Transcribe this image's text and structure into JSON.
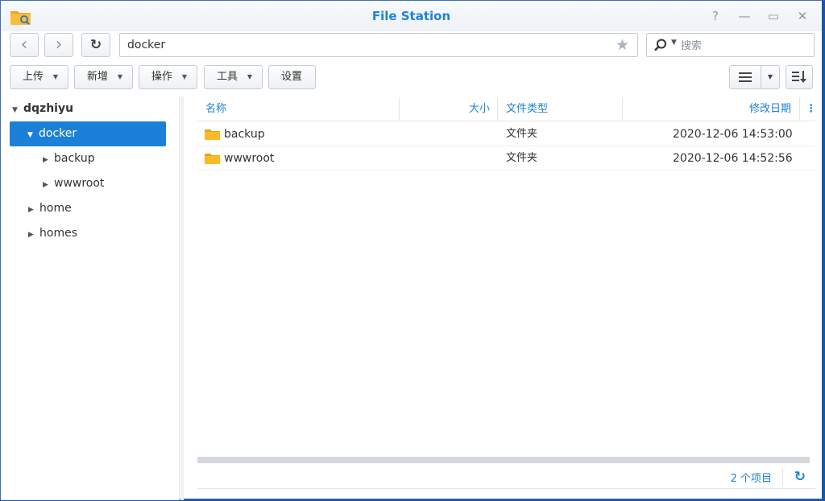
{
  "window": {
    "title": "File Station",
    "controls": {
      "help": "?",
      "minimize": "—",
      "maximize": "▭",
      "close": "✕"
    }
  },
  "nav": {
    "back_icon": "‹",
    "forward_icon": "›",
    "refresh_icon": "↻",
    "path": "docker",
    "favorite_icon": "★",
    "search_placeholder": "搜索"
  },
  "toolbar": {
    "upload": "上传",
    "create": "新增",
    "action": "操作",
    "tools": "工具",
    "settings": "设置"
  },
  "tree": {
    "root": "dqzhiyu",
    "items": [
      {
        "label": "docker",
        "expanded": true,
        "selected": true
      },
      {
        "label": "backup",
        "child": true
      },
      {
        "label": "wwwroot",
        "child": true
      },
      {
        "label": "home"
      },
      {
        "label": "homes"
      }
    ]
  },
  "list": {
    "columns": {
      "name": "名称",
      "size": "大小",
      "type": "文件类型",
      "modified": "修改日期",
      "more": "⋮"
    },
    "rows": [
      {
        "name": "backup",
        "size": "",
        "type": "文件夹",
        "modified": "2020-12-06 14:53:00"
      },
      {
        "name": "wwwroot",
        "size": "",
        "type": "文件夹",
        "modified": "2020-12-06 14:52:56"
      }
    ]
  },
  "status": {
    "count": "2 个项目",
    "refresh_icon": "↻"
  },
  "colors": {
    "accent": "#1e82d6",
    "selection": "#1c7fd8",
    "folder": "#f5a623"
  }
}
